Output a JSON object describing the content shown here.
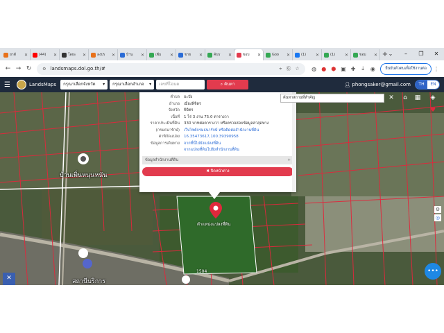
{
  "browser": {
    "tabs": [
      {
        "label": "ยาดี",
        "color": "#e8711a"
      },
      {
        "label": "(44)",
        "color": "#ff0000"
      },
      {
        "label": "โดยะ",
        "color": "#333333"
      },
      {
        "label": "ลงปร",
        "color": "#e8711a"
      },
      {
        "label": "บ้าน",
        "color": "#2a6bd6"
      },
      {
        "label": "เพิ่ม",
        "color": "#34a853"
      },
      {
        "label": "ขาย",
        "color": "#2a6bd6"
      },
      {
        "label": "ค้นร",
        "color": "#34a853"
      },
      {
        "label": "ขอบ",
        "color": "#e23b4e",
        "active": true
      },
      {
        "label": "Goo",
        "color": "#34a853"
      },
      {
        "label": "(1)",
        "color": "#1877f2"
      },
      {
        "label": "(1)",
        "color": "#34a853"
      },
      {
        "label": "ขอบ",
        "color": "#34a853"
      }
    ],
    "new_tab": "+",
    "window_controls": [
      "⌄",
      "–",
      "❐",
      "✕"
    ],
    "url": "landsmaps.dol.go.th/#",
    "profile_button": "ยืนยันตัวตนเพื่อใช้งานต่อ"
  },
  "header": {
    "brand": "LandsMaps",
    "province_select": "กรุณาเลือกจังหวัด",
    "district_select": "กรุณาเลือกอำเภอ",
    "parcel_placeholder": "เลขที่โฉนด",
    "search_label": "ค้นหา",
    "user": "phongsaker@gmail.com",
    "lang_th": "TH",
    "lang_en": "EN"
  },
  "popup": {
    "rows": [
      {
        "k": "ตำบล",
        "v": "ยะบัง",
        "link": false
      },
      {
        "k": "อำเภอ",
        "v": "เมืองพิจิตร",
        "link": false
      },
      {
        "k": "จังหวัด",
        "v": "พิจิตร",
        "link": false
      },
      {
        "k": "เนื้อที่",
        "v": "1 ไร่ 3 งาน 75.0 ตารางวา",
        "link": false
      },
      {
        "k": "ราคาประเมินที่ดิน",
        "v": "330 บาทต่อตารางวา หรือตรวจสอบข้อมูลล่าสุดทาง",
        "link": false
      },
      {
        "k": "(กรมธนารักษ์)",
        "v": "เว็บไซต์กรมธนารักษ์ หรือติดต่อสำนักงานที่ดิน",
        "link": true
      },
      {
        "k": "ค่าพิกัดแปลง",
        "v": "16.35473617,100.39390958",
        "link": true
      },
      {
        "k": "ข้อมูลการเดินทาง",
        "v": "จากที่นี่ไปยังแปลงที่ดิน",
        "link": true
      },
      {
        "k": "",
        "v": "จากแปลงที่ดินไปยังสำนักงานที่ดิน",
        "link": true
      }
    ],
    "accordion": "ข้อมูลสำนักงานที่ดิน",
    "accordion_icon": "+",
    "close_label": "ปิดหน้าต่าง"
  },
  "map": {
    "place_search": "ค้นหาสถานที่สำคัญ",
    "label_village": "บ้านเพิ่นหนุนหนัน",
    "label_station": "สถานีบริการ",
    "pin_label": "ตำแหน่งแปลงที่ดิน",
    "road_number": "1504"
  }
}
